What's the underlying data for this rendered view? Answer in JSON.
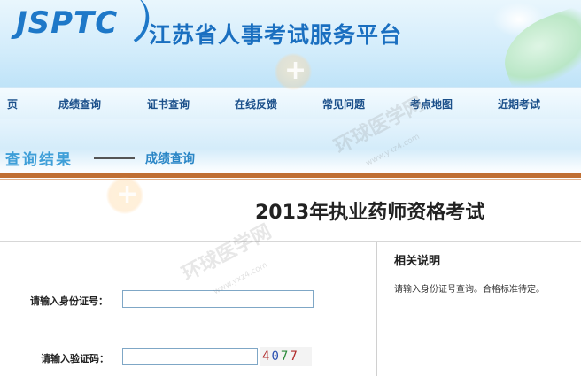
{
  "header": {
    "logo_text": "JSPTC",
    "site_title": "江苏省人事考试服务平台"
  },
  "nav": {
    "items": [
      {
        "label": "页"
      },
      {
        "label": "成绩查询"
      },
      {
        "label": "证书查询"
      },
      {
        "label": "在线反馈"
      },
      {
        "label": "常见问题"
      },
      {
        "label": "考点地图"
      },
      {
        "label": "近期考试"
      }
    ]
  },
  "subheader": {
    "title": "查询结果",
    "crumb": "成绩查询"
  },
  "main": {
    "exam_title": "2013年执业药师资格考试",
    "id_label": "请输入身份证号：",
    "id_value": "",
    "captcha_label": "请输入验证码：",
    "captcha_value": "",
    "captcha_digits": [
      "4",
      "0",
      "7",
      "7"
    ]
  },
  "side": {
    "title": "相关说明",
    "text": "请输入身份证号查询。合格标准待定。"
  },
  "watermark": {
    "text": "环球医学网",
    "url": "www.yxz4.com"
  },
  "colors": {
    "brand_blue": "#1e78c8",
    "accent_brown": "#c06f33"
  }
}
